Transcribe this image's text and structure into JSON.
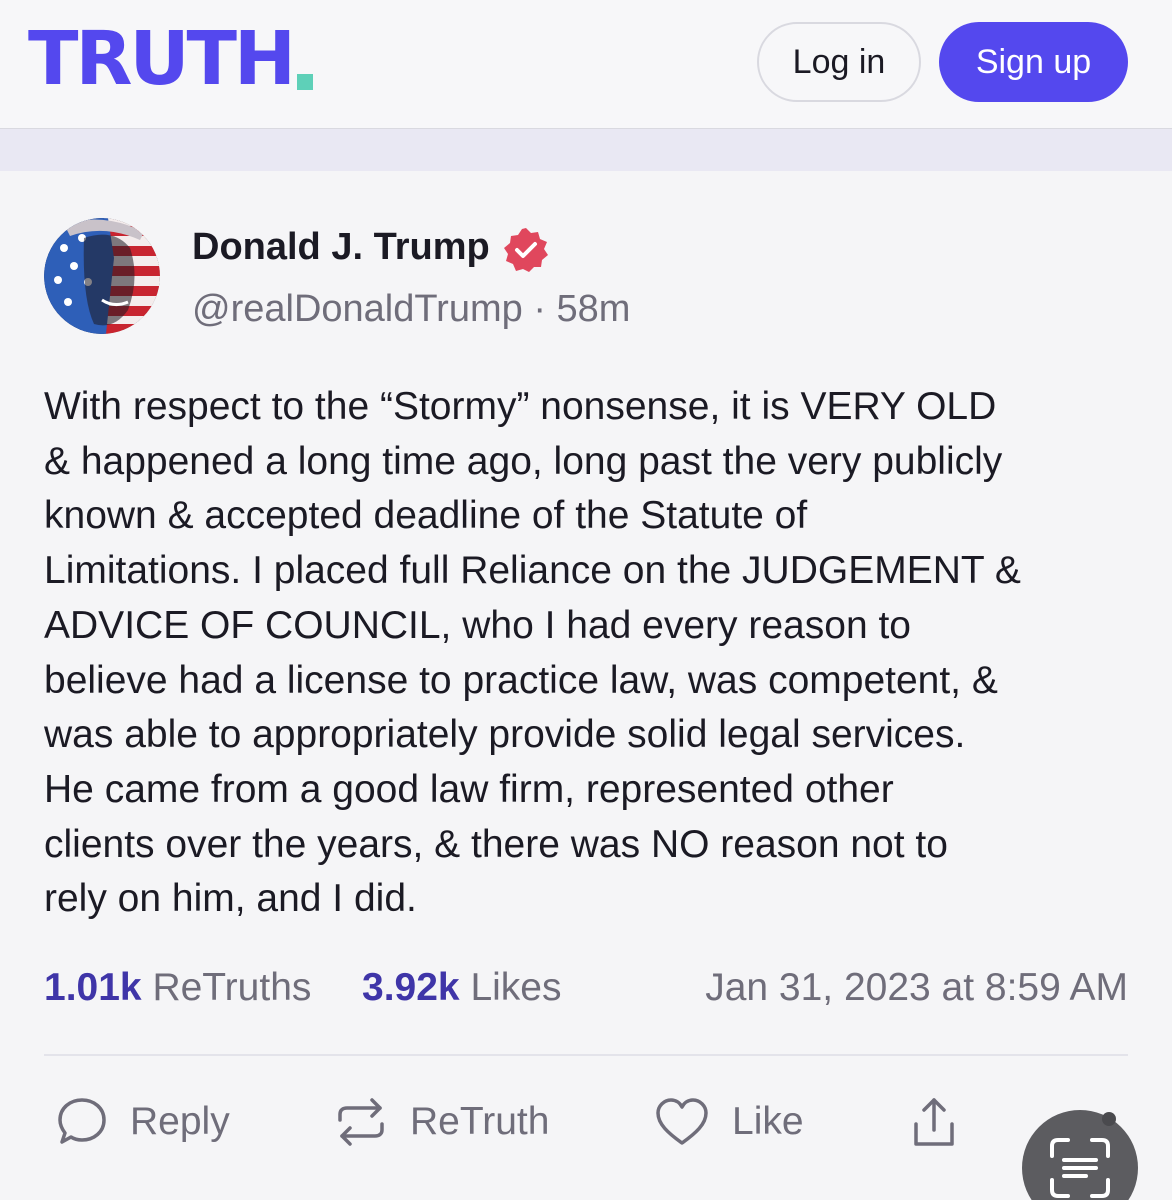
{
  "header": {
    "logo_text": "TRUTH",
    "login_label": "Log in",
    "signup_label": "Sign up"
  },
  "post": {
    "author_name": "Donald J. Trump",
    "handle": "@realDonaldTrump",
    "separator": "·",
    "relative_time": "58m",
    "lines": [
      "With respect to the “Stormy” nonsense, it is VERY OLD",
      "& happened a long time ago, long past the very publicly",
      "known & accepted deadline of the Statute of",
      "Limitations. I placed full Reliance on the JUDGEMENT &",
      "ADVICE OF COUNCIL, who I had every reason to",
      "believe had a license to practice law, was competent, &",
      "was able to appropriately provide solid legal services.",
      "He came from a good law firm, represented other",
      "clients over the years, & there was NO reason not to",
      "rely on him, and I did."
    ],
    "retruths_count": "1.01k",
    "retruths_label": "ReTruths",
    "likes_count": "3.92k",
    "likes_label": "Likes",
    "timestamp": "Jan 31, 2023 at 8:59 AM"
  },
  "actions": {
    "reply_label": "Reply",
    "retruth_label": "ReTruth",
    "like_label": "Like"
  },
  "colors": {
    "brand": "#5448ee",
    "brand_dot": "#5ed0b8",
    "stat_number": "#3f35a8",
    "verified_badge": "#e0475d"
  },
  "icons": {
    "reply": "speech-bubble-icon",
    "retruth": "repost-arrows-icon",
    "like": "heart-icon",
    "share": "share-upload-icon",
    "verified": "verified-badge-icon",
    "fab": "text-scan-icon"
  }
}
